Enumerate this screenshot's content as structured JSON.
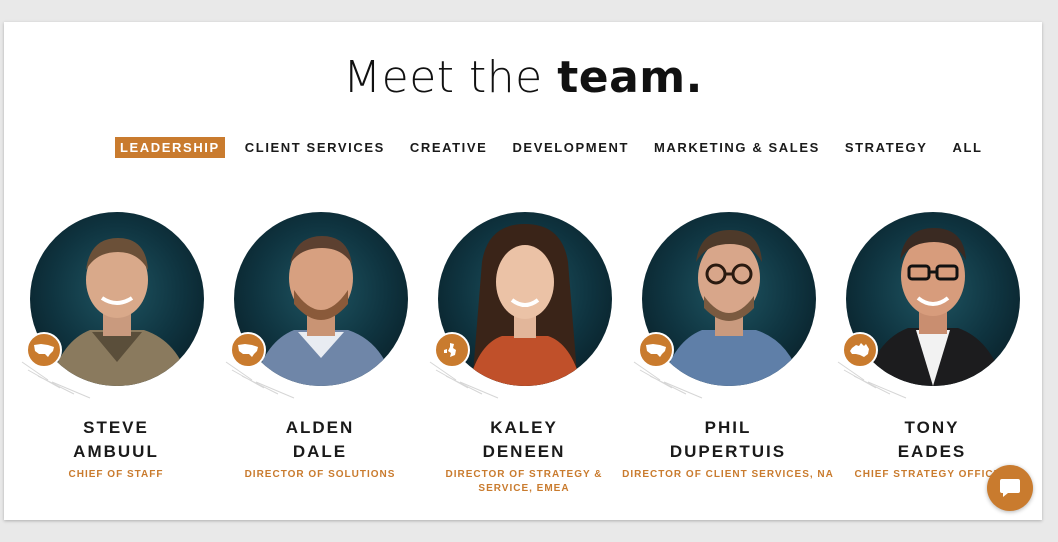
{
  "heading": {
    "light": "Meet the ",
    "bold": "team."
  },
  "tabs": [
    {
      "label": "LEADERSHIP",
      "active": true
    },
    {
      "label": "CLIENT SERVICES",
      "active": false
    },
    {
      "label": "CREATIVE",
      "active": false
    },
    {
      "label": "DEVELOPMENT",
      "active": false
    },
    {
      "label": "MARKETING & SALES",
      "active": false
    },
    {
      "label": "STRATEGY",
      "active": false
    },
    {
      "label": "ALL",
      "active": false
    }
  ],
  "members": [
    {
      "first": "STEVE",
      "last": "AMBUUL",
      "role": "CHIEF OF STAFF",
      "region_icon": "usa-map-icon"
    },
    {
      "first": "ALDEN",
      "last": "DALE",
      "role": "DIRECTOR OF SOLUTIONS",
      "region_icon": "usa-map-icon"
    },
    {
      "first": "KALEY",
      "last": "DENEEN",
      "role": "DIRECTOR OF STRATEGY & SERVICE, EMEA",
      "region_icon": "uk-map-icon"
    },
    {
      "first": "PHIL",
      "last": "DUPERTUIS",
      "role": "DIRECTOR OF CLIENT SERVICES, NA",
      "region_icon": "usa-map-icon"
    },
    {
      "first": "TONY",
      "last": "EADES",
      "role": "CHIEF STRATEGY OFFICER",
      "region_icon": "australia-map-icon"
    }
  ],
  "chat": {
    "icon": "chat-bubble-icon"
  },
  "colors": {
    "accent": "#c97b2e",
    "photo_bg": "#0f3440",
    "text": "#1a1a1a"
  }
}
